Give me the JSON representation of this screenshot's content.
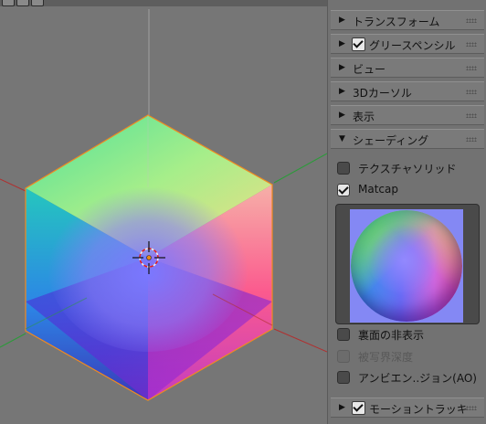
{
  "viewport": {
    "scene_icons": [
      "3d-cursor-icon"
    ]
  },
  "panel": {
    "sections": [
      {
        "label": "トランスフォーム",
        "expanded": false,
        "has_checkbox": false
      },
      {
        "label": "グリースペンシル",
        "expanded": false,
        "has_checkbox": true,
        "checked": true
      },
      {
        "label": "ビュー",
        "expanded": false,
        "has_checkbox": false
      },
      {
        "label": "3Dカーソル",
        "expanded": false,
        "has_checkbox": false
      },
      {
        "label": "表示",
        "expanded": false,
        "has_checkbox": false
      },
      {
        "label": "シェーディング",
        "expanded": true,
        "has_checkbox": false
      }
    ],
    "shading": {
      "texture_solid": {
        "label": "テクスチャソリッド",
        "checked": false
      },
      "matcap": {
        "label": "Matcap",
        "checked": true
      },
      "backface_hide": {
        "label": "裏面の非表示",
        "checked": false
      },
      "depth_of_field": {
        "label": "被写界深度",
        "checked": false,
        "disabled": true
      },
      "ambient_occlusion": {
        "label": "アンビエン..ジョン(AO)",
        "checked": false
      }
    },
    "motion_tracking": {
      "label": "モーショントラッキ",
      "checked": true
    }
  },
  "colors": {
    "background": "#767676",
    "panel": "#727272",
    "x_axis": "#b03030",
    "y_axis": "#2c9a3a",
    "z_axis": "#a0a0a0",
    "selection_outline": "#f08a20"
  }
}
